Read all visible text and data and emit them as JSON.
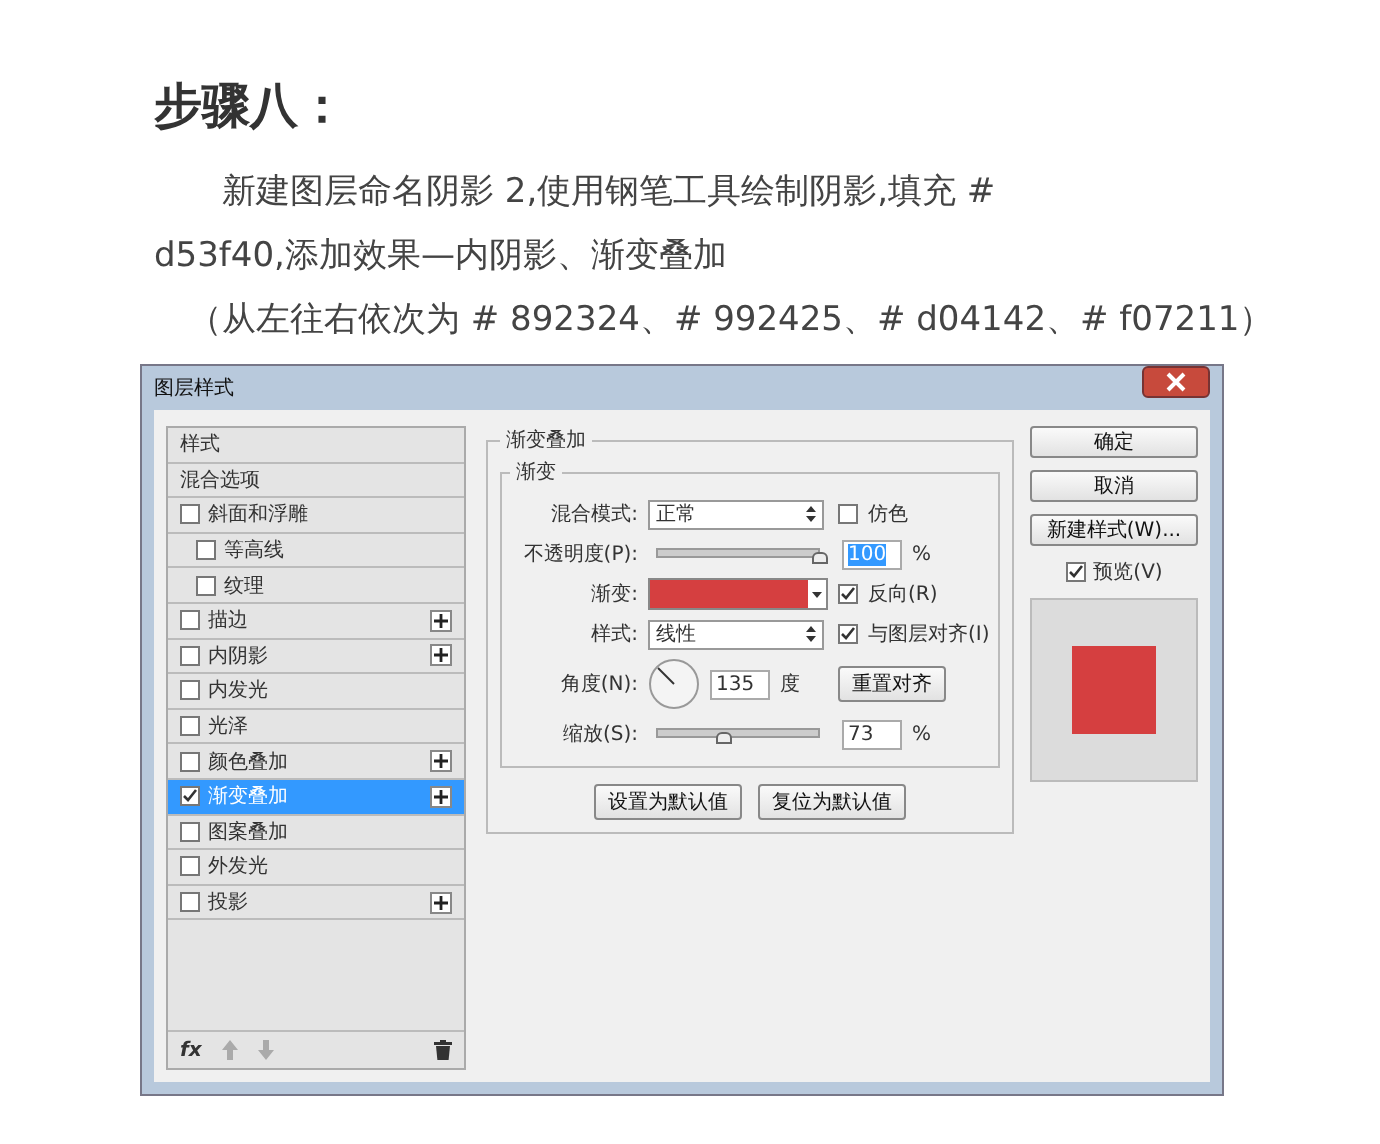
{
  "heading": "步骤八：",
  "paragraphs": [
    "新建图层命名阴影 2,使用钢笔工具绘制阴影,填充 # d53f40,添加效果—内阴影、渐变叠加",
    "（从左往右依次为 # 892324、# 992425、# d04142、# f07211）"
  ],
  "dialog": {
    "title": "图层样式",
    "styles": [
      {
        "label": "样式",
        "kind": "header",
        "selected": false
      },
      {
        "label": "混合选项",
        "kind": "header",
        "selected": false
      },
      {
        "label": "斜面和浮雕",
        "kind": "check",
        "checked": false,
        "selected": false,
        "children": [
          {
            "label": "等高线",
            "kind": "check",
            "checked": false,
            "selected": false
          },
          {
            "label": "纹理",
            "kind": "check",
            "checked": false,
            "selected": false
          }
        ]
      },
      {
        "label": "描边",
        "kind": "check",
        "checked": false,
        "selected": false,
        "plus": true
      },
      {
        "label": "内阴影",
        "kind": "check",
        "checked": false,
        "selected": false,
        "plus": true
      },
      {
        "label": "内发光",
        "kind": "check",
        "checked": false,
        "selected": false
      },
      {
        "label": "光泽",
        "kind": "check",
        "checked": false,
        "selected": false
      },
      {
        "label": "颜色叠加",
        "kind": "check",
        "checked": false,
        "selected": false,
        "plus": true
      },
      {
        "label": "渐变叠加",
        "kind": "check",
        "checked": true,
        "selected": true,
        "plus": true
      },
      {
        "label": "图案叠加",
        "kind": "check",
        "checked": false,
        "selected": false
      },
      {
        "label": "外发光",
        "kind": "check",
        "checked": false,
        "selected": false
      },
      {
        "label": "投影",
        "kind": "check",
        "checked": false,
        "selected": false,
        "plus": true
      }
    ],
    "fx": "fx",
    "group_title": "渐变叠加",
    "subgroup_title": "渐变",
    "blend_label": "混合模式:",
    "blend_value": "正常",
    "dither": {
      "label": "仿色",
      "checked": false
    },
    "opacity_label": "不透明度(P):",
    "opacity": {
      "level": 1.0
    },
    "opacity_value": "100",
    "opacity_unit": "%",
    "gradient_label": "渐变:",
    "gradient": {
      "color": "#d53f40"
    },
    "reverse": {
      "label": "反向(R)",
      "checked": true
    },
    "style_label": "样式:",
    "style_value": "线性",
    "align": {
      "label": "与图层对齐(I)",
      "checked": true
    },
    "angle_label": "角度(N):",
    "angle_value": "135",
    "angle_unit": "度",
    "reset_align": "重置对齐",
    "scale_label": "缩放(S):",
    "scale": {
      "level": 0.42
    },
    "scale_value": "73",
    "scale_unit": "%",
    "buttons": [
      "设置为默认值",
      "复位为默认值"
    ],
    "side_buttons": [
      "确定",
      "取消",
      "新建样式(W)..."
    ],
    "preview": {
      "label": "预览(V)",
      "checked": true
    },
    "preview_swatch": {
      "color": "#d53f40"
    }
  }
}
